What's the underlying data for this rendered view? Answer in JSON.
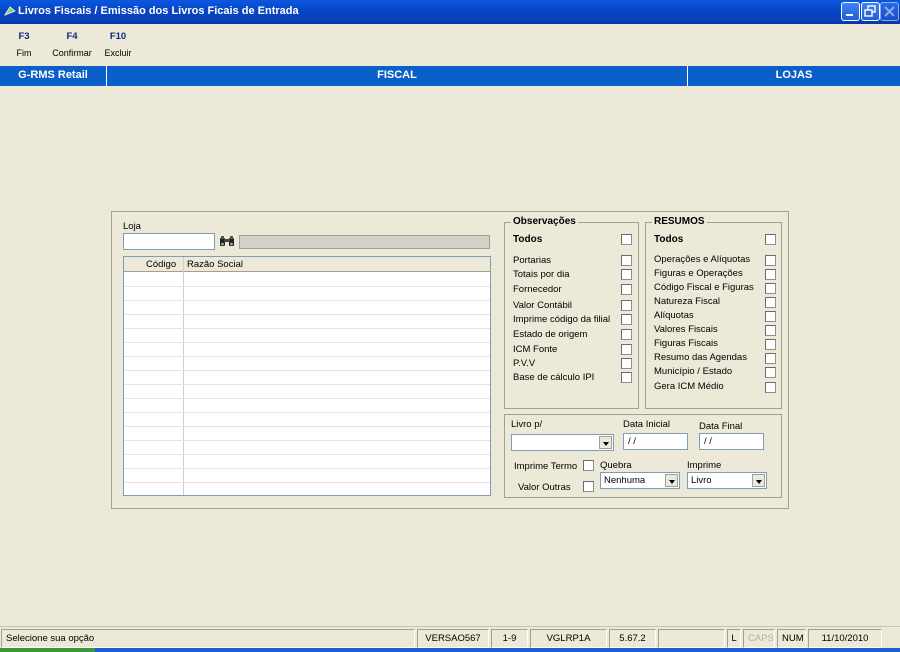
{
  "window": {
    "title": "Livros Fiscais / Emissão dos Livros Ficais de Entrada"
  },
  "toolbar": [
    {
      "key": "F3",
      "label": "Fim"
    },
    {
      "key": "F4",
      "label": "Confirmar"
    },
    {
      "key": "F10",
      "label": "Excluir"
    }
  ],
  "header": {
    "app": "G-RMS Retail",
    "module": "FISCAL",
    "area": "LOJAS"
  },
  "loja": {
    "label": "Loja",
    "code_value": "",
    "name_value": ""
  },
  "grid": {
    "columns": [
      "Código",
      "Razão Social"
    ],
    "rows": []
  },
  "observacoes": {
    "title": "Observações",
    "todos": "Todos",
    "items": [
      "Portarias",
      "Totais por dia",
      "Fornecedor",
      "Valor Contábil",
      "Imprime código da filial",
      "Estado de origem",
      "ICM Fonte",
      "P.V.V",
      "Base de cálculo IPI"
    ]
  },
  "resumos": {
    "title": "RESUMOS",
    "todos": "Todos",
    "items": [
      "Operações e Alíquotas",
      "Figuras e Operações",
      "Código Fiscal e Figuras",
      "Natureza Fiscal",
      "Alíquotas",
      "Valores Fiscais",
      "Figuras Fiscais",
      "Resumo das Agendas",
      "Município / Estado",
      "Gera ICM Médio"
    ]
  },
  "params": {
    "livro_label": "Livro p/",
    "livro_value": "",
    "data_inicial_label": "Data Inicial",
    "data_inicial_value": " / /",
    "data_final_label": "Data Final",
    "data_final_value": " / /",
    "imprime_termo_label": "Imprime Termo",
    "valor_outras_label": "Valor Outras",
    "quebra_label": "Quebra",
    "quebra_value": "Nenhuma",
    "imprime_label": "Imprime",
    "imprime_value": "Livro"
  },
  "status": {
    "message": "Selecione sua opção",
    "version": "VERSAO567",
    "page": "1-9",
    "program": "VGLRP1A",
    "build": "5.67.2",
    "blank": "",
    "l": "L",
    "caps": "CAPS",
    "num": "NUM",
    "date": "11/10/2010"
  },
  "colors": {
    "titlebar": "#0846c6",
    "header_strip": "#0b5fc9",
    "background": "#ece9d8"
  }
}
